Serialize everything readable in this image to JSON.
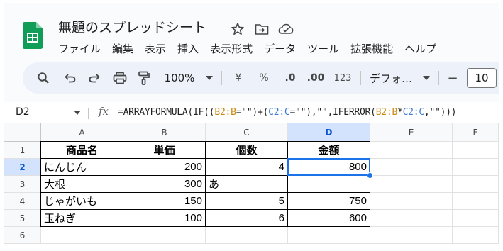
{
  "app": {
    "doc_title": "無題のスプレッドシート",
    "title_icons": [
      "star-icon",
      "move-to-folder-icon",
      "cloud-status-icon"
    ],
    "menu": [
      "ファイル",
      "編集",
      "表示",
      "挿入",
      "表示形式",
      "データ",
      "ツール",
      "拡張機能",
      "ヘルプ"
    ]
  },
  "toolbar": {
    "zoom": "100%",
    "currency": "¥",
    "percent": "%",
    "dec_decrease": ".0",
    "dec_increase": ".00",
    "number_format": "123",
    "font": "デフォ…",
    "minus": "−",
    "font_size": "10",
    "icons": [
      "search-icon",
      "undo-icon",
      "redo-icon",
      "print-icon",
      "paint-format-icon"
    ]
  },
  "formula_bar": {
    "name_box": "D2",
    "fx": "fx",
    "formula_parts": [
      {
        "t": "=ARRAYFORMULA(IF((",
        "c": ""
      },
      {
        "t": "B2:B",
        "c": "r1"
      },
      {
        "t": "=\"\")+(",
        "c": ""
      },
      {
        "t": "C2:C",
        "c": "r2"
      },
      {
        "t": "=\"\"),\"\",IFERROR(",
        "c": ""
      },
      {
        "t": "B2:B",
        "c": "r1"
      },
      {
        "t": "*",
        "c": ""
      },
      {
        "t": "C2:C",
        "c": "r2"
      },
      {
        "t": ",\"\")))",
        "c": ""
      }
    ]
  },
  "sheet": {
    "columns": [
      "A",
      "B",
      "C",
      "D",
      "E",
      "F"
    ],
    "rows": [
      "1",
      "2",
      "3",
      "4",
      "5",
      "6"
    ],
    "selected_cell": "D2",
    "cells": [
      [
        "商品名",
        "単価",
        "個数",
        "金額"
      ],
      [
        "にんじん",
        "200",
        "4",
        "800"
      ],
      [
        "大根",
        "300",
        "あ",
        ""
      ],
      [
        "じゃがいも",
        "150",
        "5",
        "750"
      ],
      [
        "玉ねぎ",
        "100",
        "6",
        "600"
      ]
    ],
    "align": [
      [
        "hdr",
        "hdr",
        "hdr",
        "hdr"
      ],
      [
        "left",
        "num",
        "num",
        "num"
      ],
      [
        "left",
        "num",
        "left",
        "num"
      ],
      [
        "left",
        "num",
        "num",
        "num"
      ],
      [
        "left",
        "num",
        "num",
        "num"
      ]
    ]
  },
  "colors": {
    "accent": "#1a73e8",
    "selected_header_bg": "#d3e3fd",
    "toolbar_bg": "#edf2fa",
    "logo_green": "#0f9d58"
  }
}
